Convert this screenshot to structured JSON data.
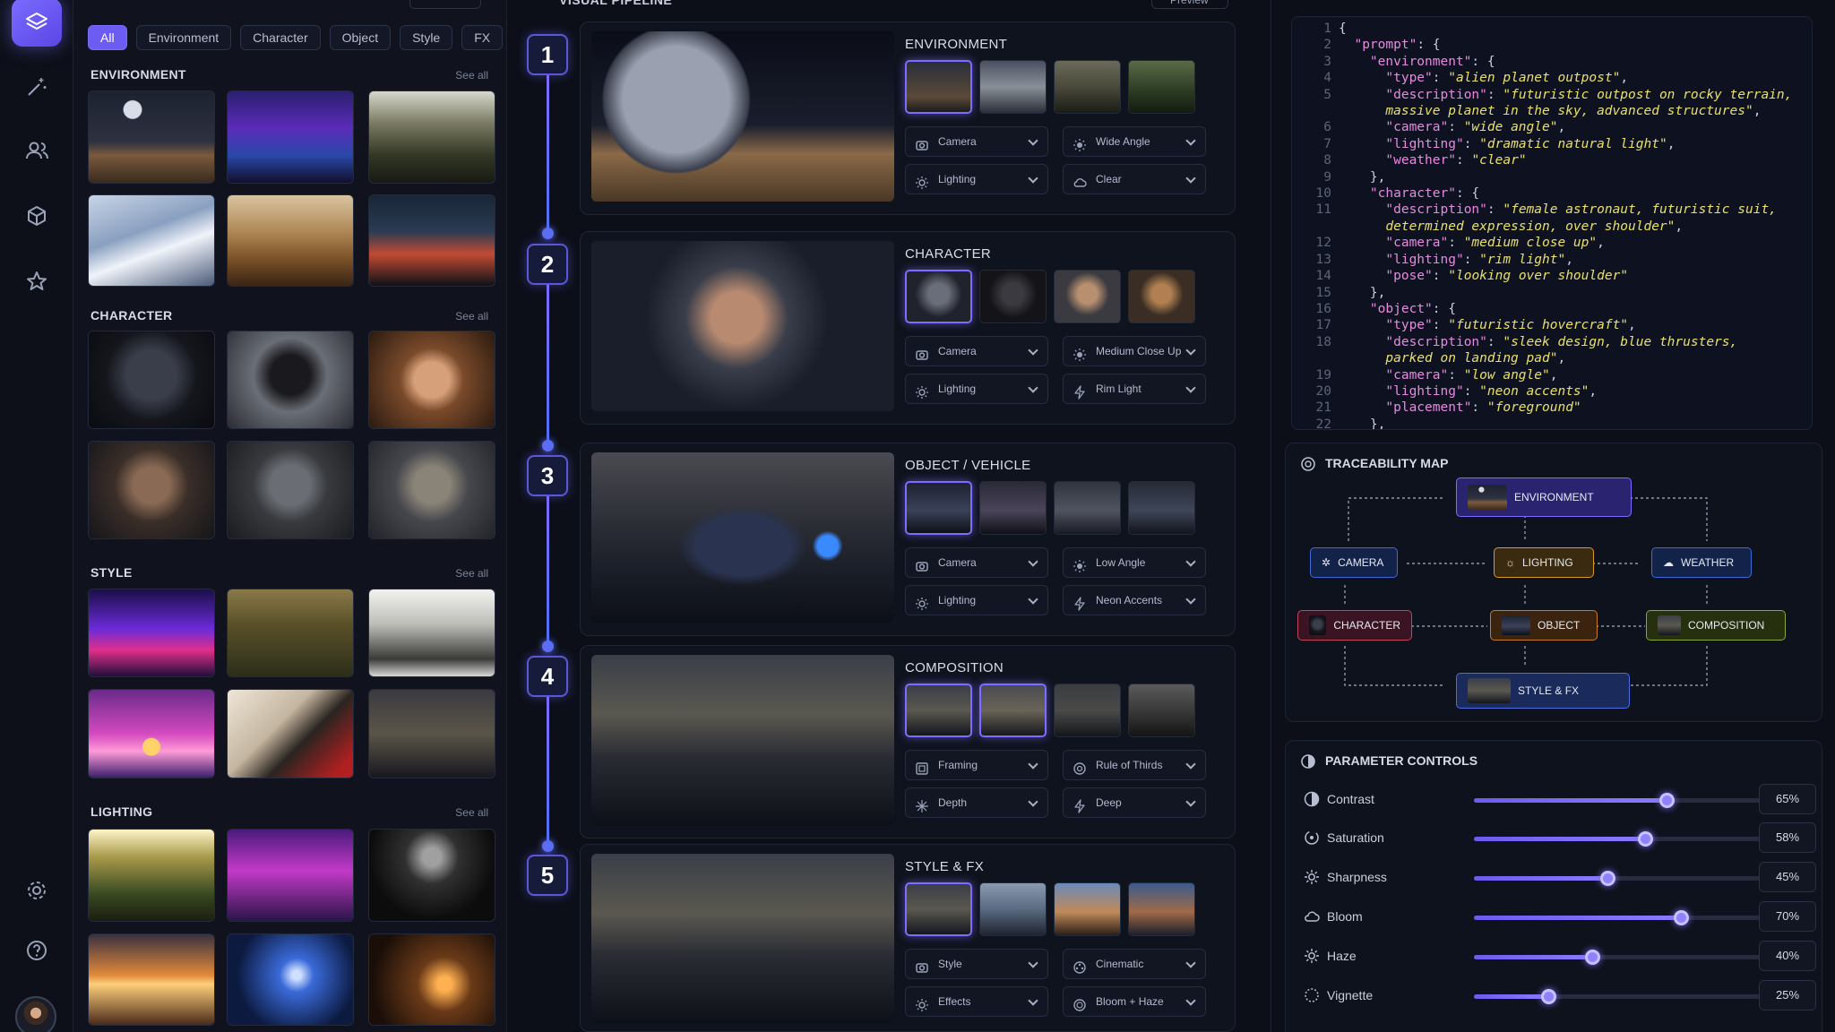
{
  "rail": {
    "icons": [
      "layers-icon",
      "magic-wand-icon",
      "users-icon",
      "cube-icon",
      "star-icon",
      "settings-icon",
      "help-icon"
    ]
  },
  "library": {
    "filters": [
      "All",
      "Environment",
      "Character",
      "Object",
      "Style",
      "FX"
    ],
    "active_filter": "All",
    "sections": [
      {
        "title": "ENVIRONMENT",
        "see_all": "See all"
      },
      {
        "title": "CHARACTER",
        "see_all": "See all"
      },
      {
        "title": "STYLE",
        "see_all": "See all"
      },
      {
        "title": "LIGHTING",
        "see_all": "See all"
      }
    ]
  },
  "pipeline": {
    "title": "VISUAL PIPELINE",
    "preview_label": "Preview",
    "steps": [
      {
        "num": "1",
        "title": "ENVIRONMENT",
        "dd": [
          "Camera",
          "Wide Angle",
          "Lighting",
          "Clear"
        ]
      },
      {
        "num": "2",
        "title": "CHARACTER",
        "dd": [
          "Camera",
          "Medium Close Up",
          "Lighting",
          "Rim Light"
        ]
      },
      {
        "num": "3",
        "title": "OBJECT / VEHICLE",
        "dd": [
          "Camera",
          "Low Angle",
          "Lighting",
          "Neon Accents"
        ]
      },
      {
        "num": "4",
        "title": "COMPOSITION",
        "dd": [
          "Framing",
          "Rule of Thirds",
          "Depth",
          "Deep"
        ]
      },
      {
        "num": "5",
        "title": "STYLE & FX",
        "dd": [
          "Style",
          "Cinematic",
          "Effects",
          "Bloom + Haze"
        ]
      }
    ]
  },
  "code": {
    "lines": [
      "1",
      "2",
      "3",
      "4",
      "5",
      "",
      "6",
      "7",
      "8",
      "9",
      "10",
      "11",
      "",
      "12",
      "13",
      "14",
      "15",
      "16",
      "17",
      "18",
      "",
      "19",
      "20",
      "21",
      "22"
    ]
  },
  "trace": {
    "title": "TRACEABILITY MAP",
    "nodes": {
      "environment": "ENVIRONMENT",
      "camera": "CAMERA",
      "lighting": "LIGHTING",
      "weather": "WEATHER",
      "character": "CHARACTER",
      "object": "OBJECT",
      "composition": "COMPOSITION",
      "style": "STYLE & FX"
    }
  },
  "params": {
    "title": "PARAMETER CONTROLS",
    "items": [
      {
        "label": "Contrast",
        "value": "65%",
        "level": 0.65
      },
      {
        "label": "Saturation",
        "value": "58%",
        "level": 0.58
      },
      {
        "label": "Sharpness",
        "value": "45%",
        "level": 0.45
      },
      {
        "label": "Bloom",
        "value": "70%",
        "level": 0.7
      },
      {
        "label": "Haze",
        "value": "40%",
        "level": 0.4
      },
      {
        "label": "Vignette",
        "value": "25%",
        "level": 0.25
      }
    ]
  },
  "colors": {
    "accent": "#7c6cff",
    "background": "#0b0e17",
    "code_key": "#e68ae0",
    "code_string": "#e9e06a"
  }
}
